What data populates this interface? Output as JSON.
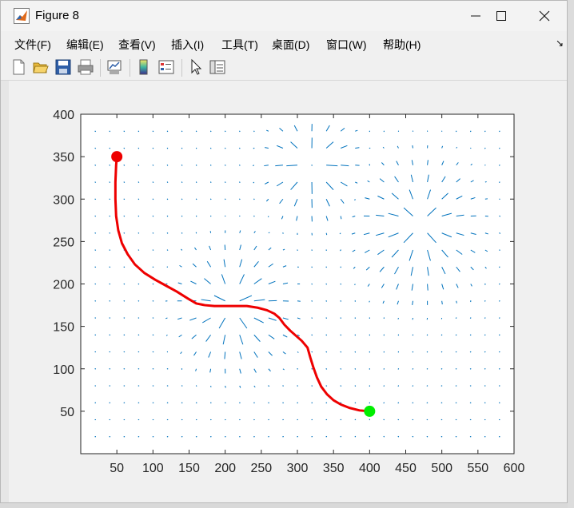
{
  "window": {
    "title": "Figure 8"
  },
  "menu": [
    "文件(F)",
    "编辑(E)",
    "查看(V)",
    "插入(I)",
    "工具(T)",
    "桌面(D)",
    "窗口(W)",
    "帮助(H)"
  ],
  "menu_arrow": "↘",
  "toolbar": [
    "new-figure",
    "open-file",
    "save",
    "print",
    "link-plot",
    "insert-colorbar",
    "insert-legend",
    "edit-plot",
    "property-inspector"
  ],
  "colors": {
    "path": "#ee0000",
    "start": "#ee0000",
    "goal": "#00ee00",
    "arrows": "#0072bd"
  },
  "chart_data": {
    "type": "line",
    "title": "",
    "xlabel": "",
    "ylabel": "",
    "xlim": [
      0,
      600
    ],
    "ylim": [
      0,
      400
    ],
    "xticks": [
      50,
      100,
      150,
      200,
      250,
      300,
      350,
      400,
      450,
      500,
      550,
      600
    ],
    "yticks": [
      50,
      100,
      150,
      200,
      250,
      300,
      350,
      400
    ],
    "xtick_labels": [
      "50",
      "100",
      "150",
      "200",
      "250",
      "300",
      "350",
      "400",
      "450",
      "500",
      "550",
      "600"
    ],
    "ytick_labels": [
      "50",
      "100",
      "150",
      "200",
      "250",
      "300",
      "350",
      "400"
    ],
    "grid": false,
    "series": [
      {
        "kind": "line",
        "x": [
          50,
          49,
          48,
          48,
          49,
          52,
          57,
          65,
          75,
          88,
          103,
          118,
          133,
          148,
          160,
          172,
          185,
          200,
          215,
          230,
          245,
          258,
          268,
          275,
          282,
          290,
          298,
          306,
          314,
          318,
          322,
          327,
          333,
          341,
          350,
          360,
          372,
          386,
          400
        ],
        "y": [
          350,
          340,
          320,
          300,
          280,
          263,
          248,
          235,
          223,
          213,
          205,
          198,
          191,
          183,
          177,
          175,
          174,
          174,
          174,
          174,
          172,
          169,
          165,
          160,
          152,
          145,
          139,
          133,
          125,
          113,
          102,
          90,
          79,
          70,
          63,
          58,
          54,
          51,
          50
        ]
      },
      {
        "kind": "marker",
        "label": "start",
        "x": 50,
        "y": 350
      },
      {
        "kind": "marker",
        "label": "goal",
        "x": 400,
        "y": 50
      }
    ],
    "quiver": {
      "x_start": 20,
      "x_step": 20,
      "x_count": 29,
      "y_start": 20,
      "y_step": 20,
      "y_count": 19,
      "description": "vector field arrows (repulsive/attractive potential field)"
    }
  }
}
